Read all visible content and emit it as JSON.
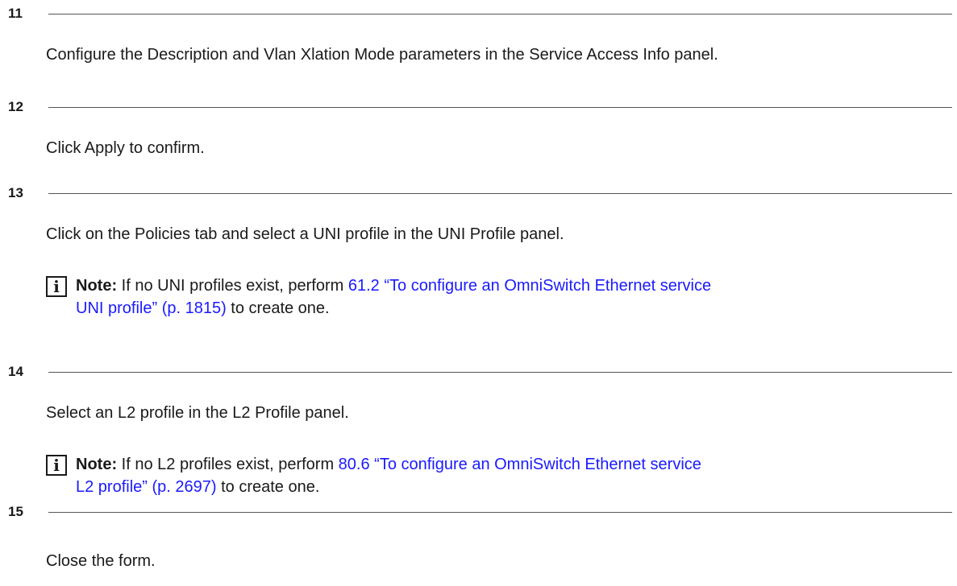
{
  "steps": [
    {
      "number": "11",
      "text": "Configure the Description and Vlan Xlation Mode parameters in the Service Access Info panel."
    },
    {
      "number": "12",
      "text": "Click Apply to confirm."
    },
    {
      "number": "13",
      "text": "Click on the Policies tab and select a UNI profile in the UNI Profile panel.",
      "note": {
        "icon": "info-icon",
        "glyph": "i",
        "label": "Note:",
        "before": " If no UNI profiles exist, perform ",
        "link_line1": "61.2 “To configure an OmniSwitch Ethernet service",
        "link_line2": "UNI profile” (p. 1815)",
        "after": " to create one."
      }
    },
    {
      "number": "14",
      "text": "Select an L2 profile in the L2 Profile panel.",
      "note": {
        "icon": "info-icon",
        "glyph": "i",
        "label": "Note:",
        "before": " If no L2 profiles exist, perform ",
        "link_line1": "80.6 “To configure an OmniSwitch Ethernet service",
        "link_line2": "L2 profile” (p. 2697)",
        "after": " to create one."
      }
    },
    {
      "number": "15",
      "text": "Close the form."
    }
  ],
  "colors": {
    "text": "#1a1a1a",
    "link": "#1a1aff",
    "rule": "#555555"
  }
}
